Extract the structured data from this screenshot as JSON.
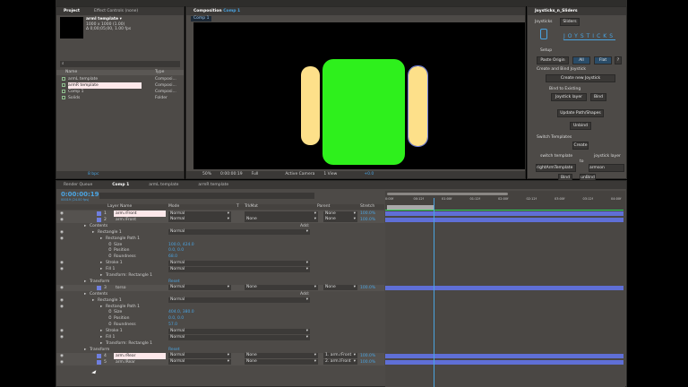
{
  "project": {
    "tab": "Project",
    "tab2": "Effect Controls (none)",
    "comp_name": "armI template ▾",
    "comp_size": "1000 x 1000 (1.00)",
    "comp_dur": "Δ 0;00;05;00, 1.00 fps",
    "search_placeholder": "⌕",
    "col_name": "Name",
    "col_type": "Type",
    "items": [
      {
        "name": "armL template",
        "type": "Composi..."
      },
      {
        "name": "armR template",
        "type": "Composi...",
        "selected": true
      },
      {
        "name": "Comp 1",
        "type": "Composi..."
      },
      {
        "name": "Solids",
        "type": "Folder"
      }
    ],
    "bpc": "8 bpc"
  },
  "composition": {
    "tab_prefix": "Composition",
    "tab_comp": "Comp 1",
    "crumb": "Comp 1",
    "zoom": "50%",
    "timecode": "0:00:00:19",
    "resolution": "Full",
    "camera": "Active Camera",
    "view": "1 View",
    "exposure": "+0.0"
  },
  "joysticks": {
    "tab": "Joysticks_n_Sliders",
    "sub_tab1": "Joysticks",
    "sub_tab2": "Sliders",
    "logo": "JOYSTICKS",
    "setup": "Setup",
    "paste_origin": "Paste Origin",
    "all": "All",
    "flat": "Flat",
    "help": "?",
    "create_bind": "Create and Bind Joystick",
    "create_new": "Create new Joystick",
    "bind_existing": "Bind to Existing",
    "joystick_layer": "Joystick layer",
    "bind": "Bind",
    "update": "Update Path/Shapes",
    "unbind": "Unbind",
    "switch_templates": "Switch Templates",
    "create": "Create",
    "switch_template": "switch template",
    "to": "to",
    "joystick_layer2": "joystick layer",
    "template_value": "rightArmTemplate",
    "layer_value": "armson",
    "bind2": "Bind",
    "unbind2": "unBind"
  },
  "timeline": {
    "tabs": [
      "Render Queue",
      "Comp 1",
      "armL template",
      "armR template"
    ],
    "timecode": "0:00:00:19",
    "frames": "00019 (24.00 fps)",
    "headers": {
      "layer_name": "Layer Name",
      "mode": "Mode",
      "t": "T",
      "trkmat": "TrkMat",
      "parent": "Parent",
      "stretch": "Stretch"
    },
    "ruler": [
      "0:00f",
      "00:12f",
      "01:00f",
      "01:12f",
      "02:00f",
      "02:12f",
      "03:00f",
      "03:12f",
      "04:00f"
    ],
    "add_label": "Add:",
    "rows": [
      {
        "kind": "layer",
        "num": "1",
        "name": "arm.rFront",
        "mode": "Normal",
        "trk": "",
        "parent": "None",
        "stretch": "100.0%",
        "hl": true
      },
      {
        "kind": "layer",
        "num": "2",
        "name": "arm.lFront",
        "mode": "Normal",
        "trk": "None",
        "parent": "None",
        "stretch": "100.0%"
      },
      {
        "kind": "prop",
        "indent": 1,
        "name": "Contents",
        "add": true
      },
      {
        "kind": "prop",
        "indent": 2,
        "name": "Rectangle 1",
        "sel": "Normal",
        "eye": true
      },
      {
        "kind": "prop",
        "indent": 3,
        "name": "Rectangle Path 1",
        "eye": true
      },
      {
        "kind": "prop",
        "indent": 4,
        "name": "Size",
        "value": "100.0, 424.0"
      },
      {
        "kind": "prop",
        "indent": 4,
        "name": "Position",
        "value": "0.0, 0.0"
      },
      {
        "kind": "prop",
        "indent": 4,
        "name": "Roundness",
        "value": "68.0"
      },
      {
        "kind": "prop",
        "indent": 3,
        "name": "Stroke 1",
        "sel": "Normal",
        "eye": true
      },
      {
        "kind": "prop",
        "indent": 3,
        "name": "Fill 1",
        "sel": "Normal",
        "eye": true
      },
      {
        "kind": "prop",
        "indent": 3,
        "name": "Transform: Rectangle 1"
      },
      {
        "kind": "prop",
        "indent": 1,
        "name": "Transform",
        "value": "Reset"
      },
      {
        "kind": "layer",
        "num": "3",
        "name": "torso",
        "mode": "Normal",
        "trk": "None",
        "parent": "None",
        "stretch": "100.0%"
      },
      {
        "kind": "prop",
        "indent": 1,
        "name": "Contents",
        "add": true
      },
      {
        "kind": "prop",
        "indent": 2,
        "name": "Rectangle 1",
        "sel": "Normal",
        "eye": true
      },
      {
        "kind": "prop",
        "indent": 3,
        "name": "Rectangle Path 1",
        "eye": true
      },
      {
        "kind": "prop",
        "indent": 4,
        "name": "Size",
        "value": "404.0, 380.0"
      },
      {
        "kind": "prop",
        "indent": 4,
        "name": "Position",
        "value": "0.0, 0.0"
      },
      {
        "kind": "prop",
        "indent": 4,
        "name": "Roundness",
        "value": "57.0"
      },
      {
        "kind": "prop",
        "indent": 3,
        "name": "Stroke 1",
        "sel": "Normal",
        "eye": true
      },
      {
        "kind": "prop",
        "indent": 3,
        "name": "Fill 1",
        "sel": "Normal",
        "eye": true
      },
      {
        "kind": "prop",
        "indent": 3,
        "name": "Transform: Rectangle 1"
      },
      {
        "kind": "prop",
        "indent": 1,
        "name": "Transform",
        "value": "Reset"
      },
      {
        "kind": "layer",
        "num": "4",
        "name": "arm.rRear",
        "mode": "Normal",
        "trk": "None",
        "parent": "1. arm.rFront",
        "stretch": "100.0%",
        "hl": true
      },
      {
        "kind": "layer",
        "num": "5",
        "name": "arm.lRear",
        "mode": "Normal",
        "trk": "None",
        "parent": "2. arm.lFront",
        "stretch": "100.0%"
      }
    ]
  },
  "colors": {
    "accent": "#4aa3e0",
    "green": "#2ef01c",
    "yellow": "#fde08a",
    "track": "#5f6fd6"
  }
}
